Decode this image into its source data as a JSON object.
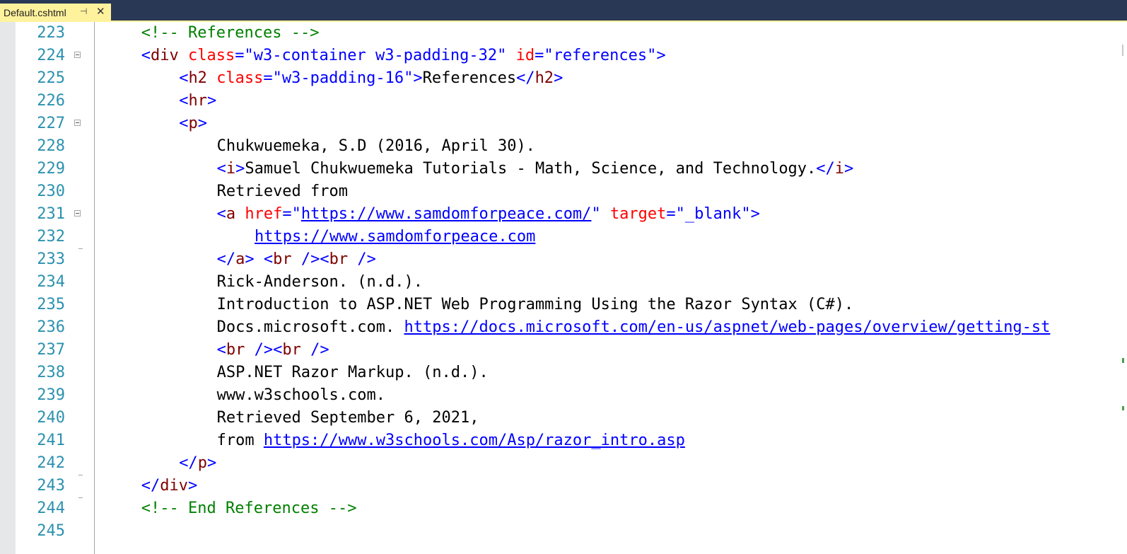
{
  "tab": {
    "label": "Default.cshtml",
    "pin_glyph": "⊣",
    "close_glyph": "✕"
  },
  "lines": [
    {
      "num": "223",
      "indent": 2,
      "fold": false,
      "tokens": [
        [
          "comment",
          "<!-- References -->"
        ]
      ]
    },
    {
      "num": "224",
      "indent": 2,
      "fold": true,
      "tokens": [
        [
          "punct",
          "<"
        ],
        [
          "tag",
          "div"
        ],
        [
          "text",
          " "
        ],
        [
          "attr",
          "class"
        ],
        [
          "punct",
          "="
        ],
        [
          "value",
          "\"w3-container w3-padding-32\""
        ],
        [
          "text",
          " "
        ],
        [
          "attr",
          "id"
        ],
        [
          "punct",
          "="
        ],
        [
          "value",
          "\"references\""
        ],
        [
          "punct",
          ">"
        ]
      ]
    },
    {
      "num": "225",
      "indent": 3,
      "fold": false,
      "tokens": [
        [
          "punct",
          "<"
        ],
        [
          "tag",
          "h2"
        ],
        [
          "text",
          " "
        ],
        [
          "attr",
          "class"
        ],
        [
          "punct",
          "="
        ],
        [
          "value",
          "\"w3-padding-16\""
        ],
        [
          "punct",
          ">"
        ],
        [
          "text",
          "References"
        ],
        [
          "punct",
          "</"
        ],
        [
          "tag",
          "h2"
        ],
        [
          "punct",
          ">"
        ]
      ]
    },
    {
      "num": "226",
      "indent": 3,
      "fold": false,
      "tokens": [
        [
          "punct",
          "<"
        ],
        [
          "tag",
          "hr"
        ],
        [
          "punct",
          ">"
        ]
      ]
    },
    {
      "num": "227",
      "indent": 3,
      "fold": true,
      "tokens": [
        [
          "punct",
          "<"
        ],
        [
          "tag",
          "p"
        ],
        [
          "punct",
          ">"
        ]
      ]
    },
    {
      "num": "228",
      "indent": 4,
      "fold": false,
      "tokens": [
        [
          "text",
          "Chukwuemeka, S.D (2016, April 30)."
        ]
      ]
    },
    {
      "num": "229",
      "indent": 4,
      "fold": false,
      "tokens": [
        [
          "punct",
          "<"
        ],
        [
          "tag",
          "i"
        ],
        [
          "punct",
          ">"
        ],
        [
          "text",
          "Samuel Chukwuemeka Tutorials - Math, Science, and Technology."
        ],
        [
          "punct",
          "</"
        ],
        [
          "tag",
          "i"
        ],
        [
          "punct",
          ">"
        ]
      ]
    },
    {
      "num": "230",
      "indent": 4,
      "fold": false,
      "tokens": [
        [
          "text",
          "Retrieved from"
        ]
      ]
    },
    {
      "num": "231",
      "indent": 4,
      "fold": true,
      "tokens": [
        [
          "punct",
          "<"
        ],
        [
          "tag",
          "a"
        ],
        [
          "text",
          " "
        ],
        [
          "attr",
          "href"
        ],
        [
          "punct",
          "=\""
        ],
        [
          "link",
          "https://www.samdomforpeace.com/"
        ],
        [
          "punct",
          "\""
        ],
        [
          "text",
          " "
        ],
        [
          "attr",
          "target"
        ],
        [
          "punct",
          "="
        ],
        [
          "value",
          "\"_blank\""
        ],
        [
          "punct",
          ">"
        ]
      ]
    },
    {
      "num": "232",
      "indent": 5,
      "fold": false,
      "tokens": [
        [
          "link",
          "https://www.samdomforpeace.com"
        ]
      ]
    },
    {
      "num": "233",
      "indent": 4,
      "fold": false,
      "tick": true,
      "tokens": [
        [
          "punct",
          "</"
        ],
        [
          "tag",
          "a"
        ],
        [
          "punct",
          ">"
        ],
        [
          "text",
          " "
        ],
        [
          "punct",
          "<"
        ],
        [
          "tag",
          "br"
        ],
        [
          "text",
          " "
        ],
        [
          "punct",
          "/><"
        ],
        [
          "tag",
          "br"
        ],
        [
          "text",
          " "
        ],
        [
          "punct",
          "/>"
        ]
      ]
    },
    {
      "num": "234",
      "indent": 4,
      "fold": false,
      "tokens": [
        [
          "text",
          "Rick-Anderson. (n.d.)."
        ]
      ]
    },
    {
      "num": "235",
      "indent": 4,
      "fold": false,
      "tokens": [
        [
          "text",
          "Introduction to ASP.NET Web Programming Using the Razor Syntax (C#)."
        ]
      ]
    },
    {
      "num": "236",
      "indent": 4,
      "fold": false,
      "tokens": [
        [
          "text",
          "Docs.microsoft.com. "
        ],
        [
          "link",
          "https://docs.microsoft.com/en-us/aspnet/web-pages/overview/getting-st"
        ]
      ]
    },
    {
      "num": "237",
      "indent": 4,
      "fold": false,
      "tokens": [
        [
          "punct",
          "<"
        ],
        [
          "tag",
          "br"
        ],
        [
          "text",
          " "
        ],
        [
          "punct",
          "/><"
        ],
        [
          "tag",
          "br"
        ],
        [
          "text",
          " "
        ],
        [
          "punct",
          "/>"
        ]
      ]
    },
    {
      "num": "238",
      "indent": 4,
      "fold": false,
      "tokens": [
        [
          "text",
          "ASP.NET Razor Markup. (n.d.)."
        ]
      ]
    },
    {
      "num": "239",
      "indent": 4,
      "fold": false,
      "tokens": [
        [
          "text",
          "www.w3schools.com."
        ]
      ]
    },
    {
      "num": "240",
      "indent": 4,
      "fold": false,
      "tokens": [
        [
          "text",
          "Retrieved September 6, 2021,"
        ]
      ]
    },
    {
      "num": "241",
      "indent": 4,
      "fold": false,
      "tokens": [
        [
          "text",
          "from "
        ],
        [
          "link",
          "https://www.w3schools.com/Asp/razor_intro.asp"
        ]
      ]
    },
    {
      "num": "242",
      "indent": 3,
      "fold": false,
      "tokens": [
        [
          "punct",
          "</"
        ],
        [
          "tag",
          "p"
        ],
        [
          "punct",
          ">"
        ]
      ]
    },
    {
      "num": "243",
      "indent": 2,
      "fold": false,
      "tick": true,
      "tokens": [
        [
          "punct",
          "</"
        ],
        [
          "tag",
          "div"
        ],
        [
          "punct",
          ">"
        ]
      ]
    },
    {
      "num": "244",
      "indent": 2,
      "fold": false,
      "tick": true,
      "tokens": [
        [
          "comment",
          "<!-- End References -->"
        ]
      ]
    },
    {
      "num": "245",
      "indent": 2,
      "fold": false,
      "tokens": []
    }
  ]
}
